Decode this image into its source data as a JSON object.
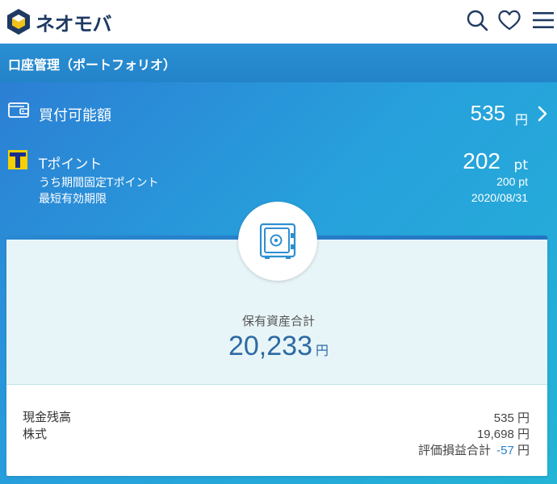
{
  "header": {
    "logo_text": "ネオモバ",
    "icons": [
      "search-icon",
      "heart-icon",
      "menu-icon"
    ],
    "accent_color": "#1f3a62"
  },
  "subheader": {
    "title": "口座管理（ポートフォリオ）",
    "color": "#2a8fd3"
  },
  "buying_power": {
    "label": "買付可能額",
    "amount": "535",
    "unit": "円"
  },
  "tpoint": {
    "label": "Tポイント",
    "value": "202",
    "unit": "pt",
    "fixed_label": "うち期間固定Tポイント",
    "fixed_value": "200 pt",
    "expiry_label": "最短有効期限",
    "expiry_value": "2020/08/31"
  },
  "assets": {
    "icon": "safe-icon",
    "total_label": "保有資産合計",
    "total_value": "20,233",
    "total_unit": "円",
    "total_color": "#2d6aa3",
    "cash_label": "現金残高",
    "cash_value": "535 円",
    "stocks_label": "株式",
    "stocks_value": "19,698 円",
    "pl_label": "評価損益合計",
    "pl_value": "-57",
    "pl_unit": "円",
    "pl_color": "#2a7fc9"
  }
}
